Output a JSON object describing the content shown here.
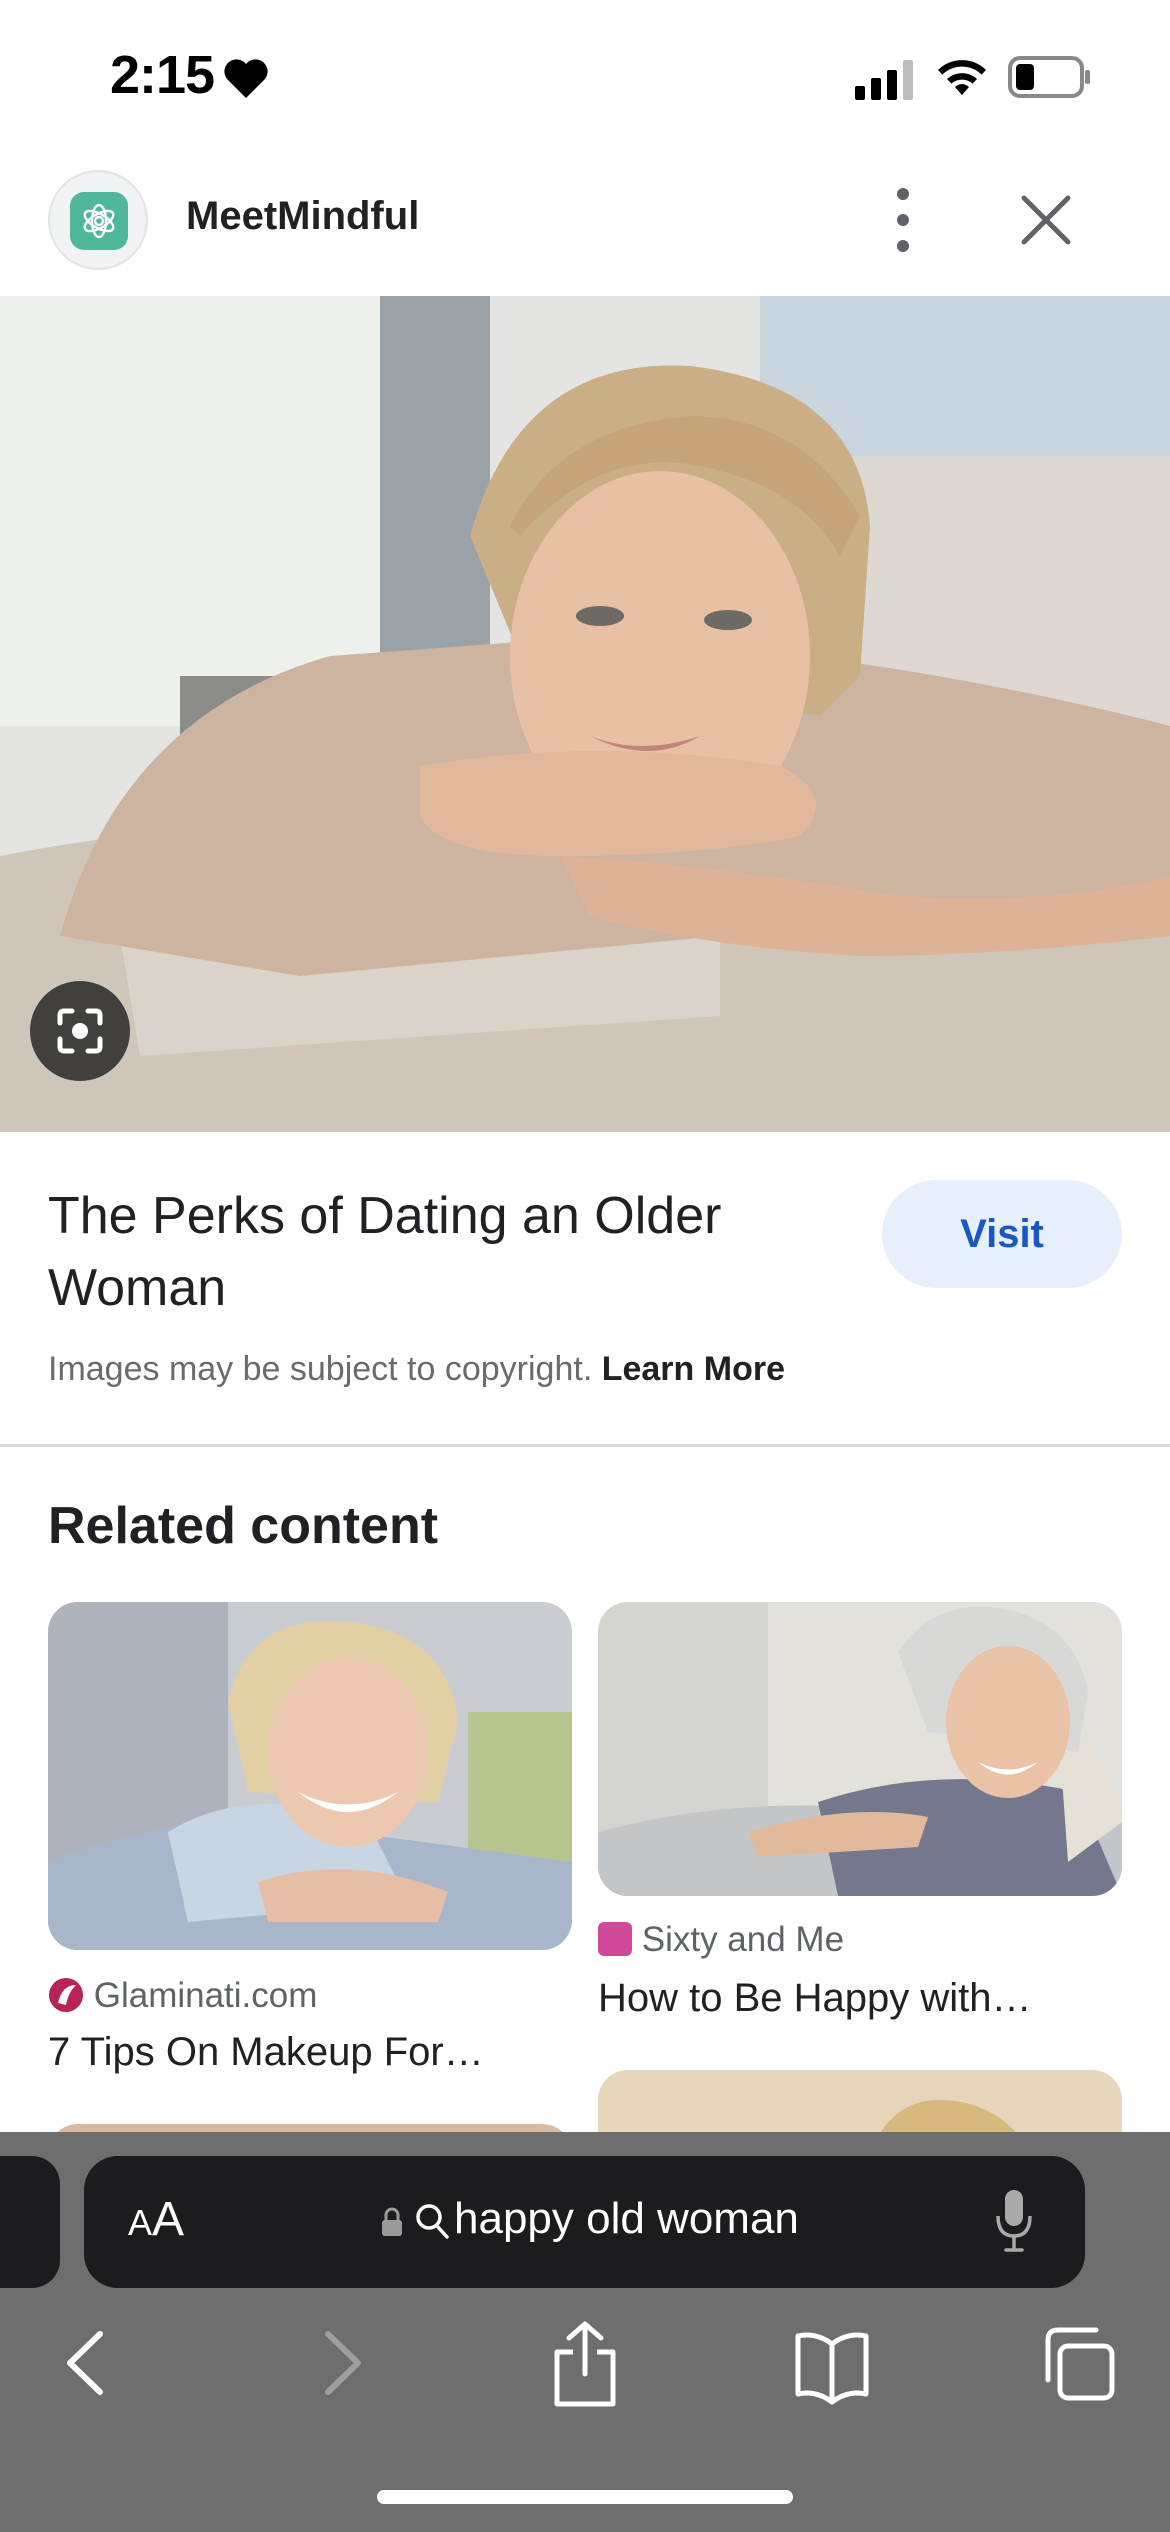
{
  "status_bar": {
    "time": "2:15"
  },
  "site": {
    "name": "MeetMindful"
  },
  "result": {
    "title": "The Perks of Dating an Older Woman",
    "visit_label": "Visit",
    "copyright_text": "Images may be subject to copyright.",
    "learn_more": "Learn More"
  },
  "related": {
    "heading": "Related content",
    "cards": [
      {
        "source": "Glaminati.com",
        "title": "7 Tips On Makeup For…"
      },
      {
        "source": "Sixty and Me",
        "title": "How to Be Happy with…"
      }
    ]
  },
  "browser": {
    "aa_label_small": "A",
    "aa_label_large": "A",
    "url_text": "happy old woman"
  },
  "colors": {
    "visit_bg": "#e8effc",
    "visit_text": "#1a56c4",
    "logo_green": "#4fb79a",
    "sixty_brand": "#d14a9a"
  }
}
